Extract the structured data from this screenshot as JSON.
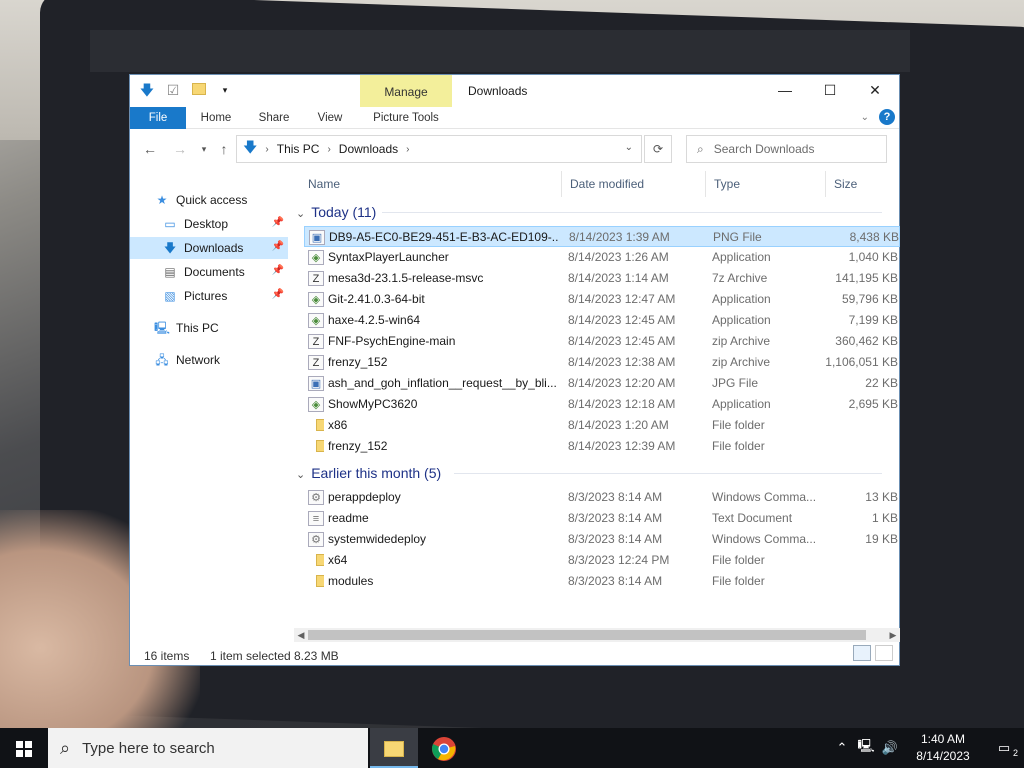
{
  "window": {
    "title": "Downloads",
    "context_tab": "Manage",
    "tabs": [
      "File",
      "Home",
      "Share",
      "View",
      "Picture Tools"
    ],
    "help": "?",
    "minimize": "—",
    "maximize": "☐",
    "close": "✕"
  },
  "address": {
    "crumbs": [
      "This PC",
      "Downloads"
    ],
    "search_placeholder": "Search Downloads"
  },
  "nav": [
    {
      "label": "Quick access",
      "icon": "star-icon",
      "pinned": false
    },
    {
      "label": "Desktop",
      "icon": "desktop-icon",
      "pinned": true
    },
    {
      "label": "Downloads",
      "icon": "download-icon",
      "pinned": true,
      "selected": true
    },
    {
      "label": "Documents",
      "icon": "document-icon",
      "pinned": true
    },
    {
      "label": "Pictures",
      "icon": "pictures-icon",
      "pinned": true
    },
    {
      "label": "This PC",
      "icon": "computer-icon",
      "pinned": false
    },
    {
      "label": "Network",
      "icon": "network-icon",
      "pinned": false
    }
  ],
  "columns": [
    "Name",
    "Date modified",
    "Type",
    "Size"
  ],
  "groups": [
    {
      "label": "Today (11)",
      "files": [
        {
          "name": "DB9-A5-EC0-BE29-451-E-B3-AC-ED109-...",
          "date": "8/14/2023 1:39 AM",
          "type": "PNG File",
          "size": "8,438 KB",
          "icon": "image-file-icon",
          "selected": true
        },
        {
          "name": "SyntaxPlayerLauncher",
          "date": "8/14/2023 1:26 AM",
          "type": "Application",
          "size": "1,040 KB",
          "icon": "app-icon"
        },
        {
          "name": "mesa3d-23.1.5-release-msvc",
          "date": "8/14/2023 1:14 AM",
          "type": "7z Archive",
          "size": "141,195 KB",
          "icon": "archive-icon"
        },
        {
          "name": "Git-2.41.0.3-64-bit",
          "date": "8/14/2023 12:47 AM",
          "type": "Application",
          "size": "59,796 KB",
          "icon": "app-icon"
        },
        {
          "name": "haxe-4.2.5-win64",
          "date": "8/14/2023 12:45 AM",
          "type": "Application",
          "size": "7,199 KB",
          "icon": "app-icon"
        },
        {
          "name": "FNF-PsychEngine-main",
          "date": "8/14/2023 12:45 AM",
          "type": "zip Archive",
          "size": "360,462 KB",
          "icon": "archive-icon"
        },
        {
          "name": "frenzy_152",
          "date": "8/14/2023 12:38 AM",
          "type": "zip Archive",
          "size": "1,106,051 KB",
          "icon": "archive-icon"
        },
        {
          "name": "ash_and_goh_inflation__request__by_bli...",
          "date": "8/14/2023 12:20 AM",
          "type": "JPG File",
          "size": "22 KB",
          "icon": "image-file-icon"
        },
        {
          "name": "ShowMyPC3620",
          "date": "8/14/2023 12:18 AM",
          "type": "Application",
          "size": "2,695 KB",
          "icon": "app-icon"
        },
        {
          "name": "x86",
          "date": "8/14/2023 1:20 AM",
          "type": "File folder",
          "size": "",
          "icon": "folder-icon"
        },
        {
          "name": "frenzy_152",
          "date": "8/14/2023 12:39 AM",
          "type": "File folder",
          "size": "",
          "icon": "folder-icon"
        }
      ]
    },
    {
      "label": "Earlier this month (5)",
      "files": [
        {
          "name": "perappdeploy",
          "date": "8/3/2023 8:14 AM",
          "type": "Windows Comma...",
          "size": "13 KB",
          "icon": "script-icon"
        },
        {
          "name": "readme",
          "date": "8/3/2023 8:14 AM",
          "type": "Text Document",
          "size": "1 KB",
          "icon": "text-file-icon"
        },
        {
          "name": "systemwidedeploy",
          "date": "8/3/2023 8:14 AM",
          "type": "Windows Comma...",
          "size": "19 KB",
          "icon": "script-icon"
        },
        {
          "name": "x64",
          "date": "8/3/2023 12:24 PM",
          "type": "File folder",
          "size": "",
          "icon": "folder-icon"
        },
        {
          "name": "modules",
          "date": "8/3/2023 8:14 AM",
          "type": "File folder",
          "size": "",
          "icon": "folder-icon"
        }
      ]
    }
  ],
  "status": {
    "items": "16 items",
    "selected": "1 item selected",
    "size": "8.23 MB"
  },
  "taskbar": {
    "search_placeholder": "Type here to search",
    "time": "1:40 AM",
    "date": "8/14/2023",
    "notifications": "2"
  },
  "colors": {
    "accent": "#1979ca",
    "selection": "#cce8ff",
    "context_tab": "#f3ef9b"
  }
}
